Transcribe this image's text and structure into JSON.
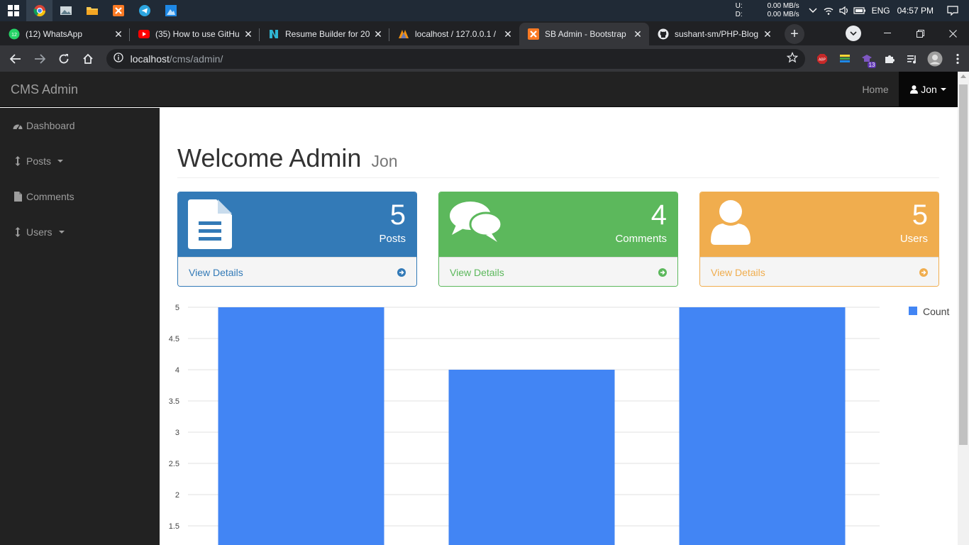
{
  "taskbar": {
    "net_up_label": "U:",
    "net_up_value": "0.00 MB/s",
    "net_down_label": "D:",
    "net_down_value": "0.00 MB/s",
    "language": "ENG",
    "time": "04:57 PM"
  },
  "browser": {
    "tabs": [
      {
        "title": "(12) WhatsApp",
        "favicon": "whatsapp-icon",
        "badge": "12"
      },
      {
        "title": "(35) How to use GitHu",
        "favicon": "youtube-icon"
      },
      {
        "title": "Resume Builder for 20",
        "favicon": "novoresume-icon"
      },
      {
        "title": "localhost / 127.0.0.1 / ",
        "favicon": "phpmyadmin-icon"
      },
      {
        "title": "SB Admin - Bootstrap",
        "favicon": "xampp-icon"
      },
      {
        "title": "sushant-sm/PHP-Blog",
        "favicon": "github-icon"
      }
    ],
    "active_tab": 4,
    "address_host": "localhost",
    "address_path": "/cms/admin/",
    "extension_badge": "13"
  },
  "page": {
    "brand": "CMS Admin",
    "nav_home": "Home",
    "nav_user": "Jon",
    "sidebar": [
      {
        "label": "Dashboard",
        "icon": "dashboard-icon",
        "dropdown": false
      },
      {
        "label": "Posts",
        "icon": "arrows-v-icon",
        "dropdown": true
      },
      {
        "label": "Comments",
        "icon": "file-icon",
        "dropdown": false
      },
      {
        "label": "Users",
        "icon": "arrows-v-icon",
        "dropdown": true
      }
    ],
    "heading": "Welcome Admin",
    "heading_small": "Jon",
    "panels": [
      {
        "count": "5",
        "label": "Posts",
        "footer": "View Details",
        "icon": "file-text-icon",
        "color": "#337ab7"
      },
      {
        "count": "4",
        "label": "Comments",
        "footer": "View Details",
        "icon": "comments-icon",
        "color": "#5cb85c"
      },
      {
        "count": "5",
        "label": "Users",
        "footer": "View Details",
        "icon": "user-icon",
        "color": "#f0ad4e"
      }
    ]
  },
  "chart_data": {
    "type": "bar",
    "categories": [
      "",
      "",
      ""
    ],
    "series": [
      {
        "name": "Count",
        "values": [
          5,
          4,
          5
        ],
        "color": "#4285f4"
      }
    ],
    "y_ticks": [
      "5",
      "4.5",
      "4",
      "3.5",
      "3",
      "2.5",
      "2",
      "1.5"
    ],
    "ylim": [
      0,
      5
    ],
    "legend_position": "right",
    "grid": true
  }
}
